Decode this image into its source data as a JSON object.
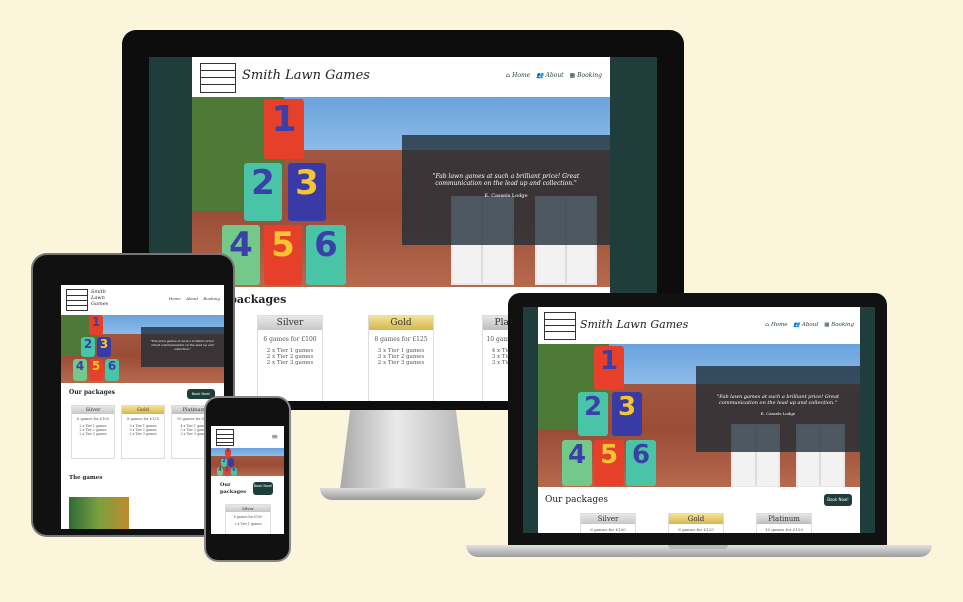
{
  "site": {
    "brand": "Smith Lawn Games",
    "nav": [
      {
        "icon": "home-icon",
        "label": "Home"
      },
      {
        "icon": "users-icon",
        "label": "About"
      },
      {
        "icon": "calendar-icon",
        "label": "Booking"
      }
    ],
    "quote": "\"Fab lawn games at such a brilliant price! Great communication on the lead up and collection.\"",
    "quote_author": "E. Cassels Lodge",
    "packages_title": "Our packages",
    "book_button": "Book Now!",
    "games_title": "The games",
    "packages": [
      {
        "name": "Silver",
        "games": "6 games for £100",
        "lines": [
          "2 x Tier 1 games",
          "2 x Tier 2 games",
          "2 x Tier 3 games"
        ]
      },
      {
        "name": "Gold",
        "games": "8 games for £125",
        "lines": [
          "3 x Tier 1 games",
          "3 x Tier 2 games",
          "2 x Tier 3 games"
        ]
      },
      {
        "name": "Platinum",
        "games": "10 games for £150",
        "lines": [
          "4 x Tier 1 games",
          "3 x Tier 2 games",
          "3 x Tier 3 games"
        ]
      }
    ],
    "can_numbers": [
      "1",
      "2",
      "3",
      "4",
      "5",
      "6"
    ]
  },
  "colors": {
    "page_background": "#fbf5dc",
    "brand_dark": "#1e3d3b",
    "gold": "#d6b64c"
  }
}
